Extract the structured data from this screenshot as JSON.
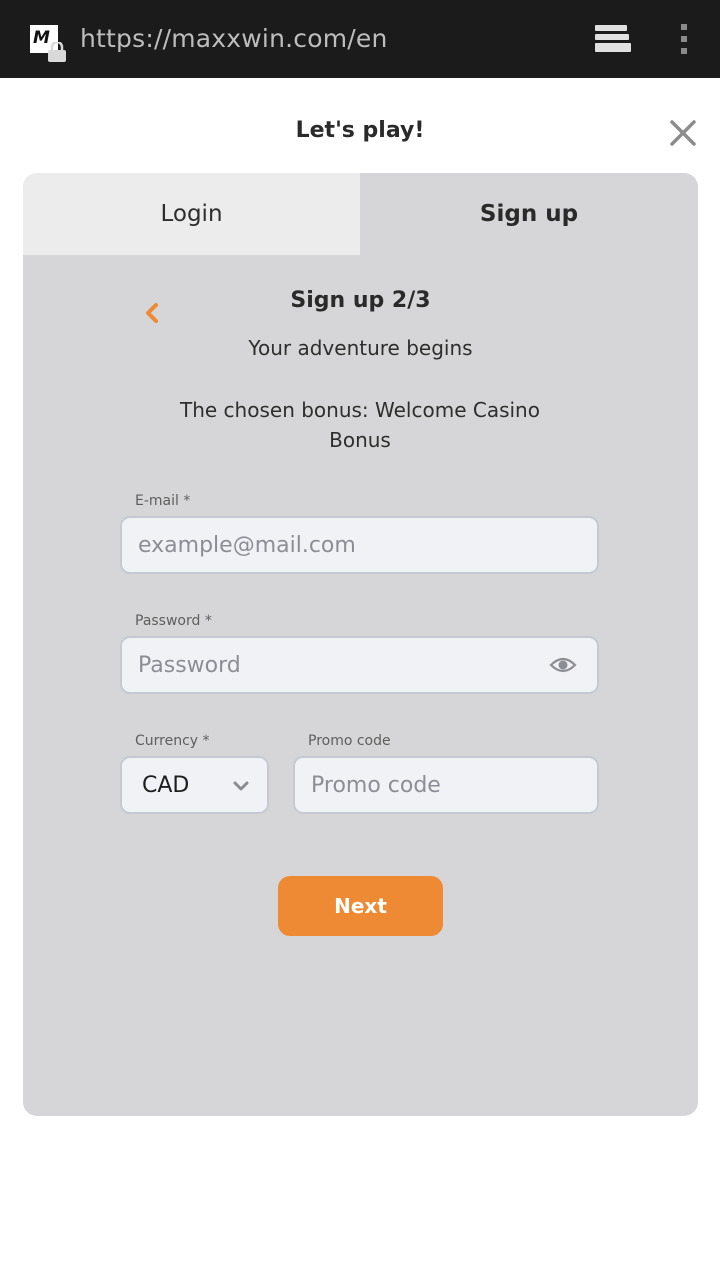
{
  "browser": {
    "url": "https://maxxwin.com/en",
    "site_icon_letter": "M",
    "icons": [
      "site-favicon",
      "lock-icon",
      "tabs-icon",
      "overflow-menu-icon"
    ]
  },
  "modal": {
    "title": "Let's play!",
    "close_icon": "close-icon"
  },
  "tabs": [
    {
      "label": "Login",
      "active": false
    },
    {
      "label": "Sign up",
      "active": true
    }
  ],
  "step": {
    "title": "Sign up 2/3",
    "subtitle": "Your adventure begins",
    "bonus_text": "The chosen bonus: Welcome Casino Bonus"
  },
  "form": {
    "email": {
      "label": "E-mail *",
      "value": "",
      "placeholder": "example@mail.com"
    },
    "password": {
      "label": "Password *",
      "value": "",
      "placeholder": "Password"
    },
    "currency": {
      "label": "Currency *",
      "selected": "CAD"
    },
    "promo": {
      "label": "Promo code",
      "value": "",
      "placeholder": "Promo code"
    },
    "next_label": "Next"
  },
  "colors": {
    "accent": "#ee8a33",
    "card_bg": "#d6d6d8",
    "browser_bar": "#1b1b1b"
  }
}
